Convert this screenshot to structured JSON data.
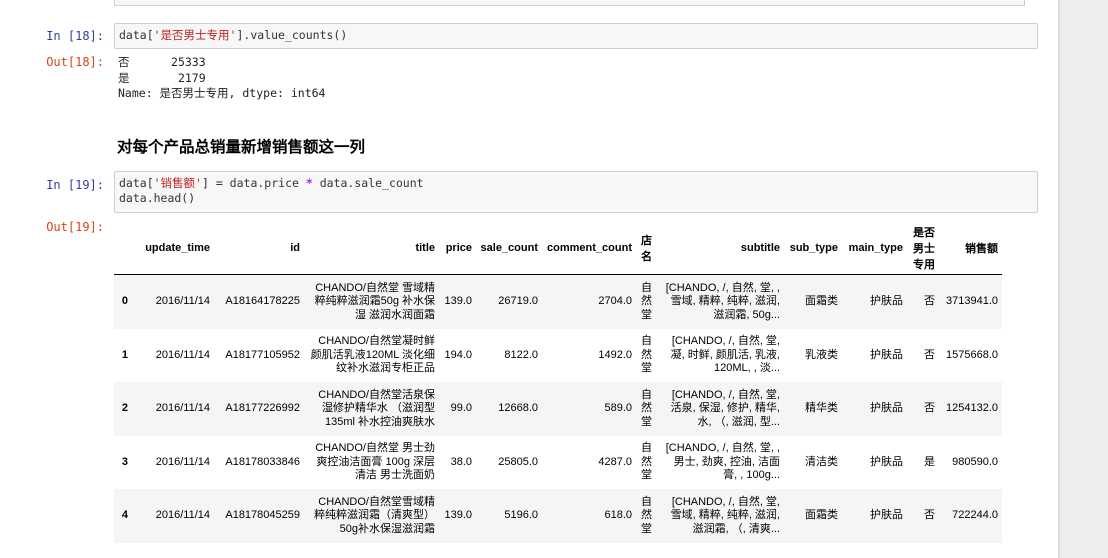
{
  "cell18": {
    "in_prompt": "In  [18]:",
    "code": {
      "a": "data[",
      "str": "'是否男士专用'",
      "b": "].value_counts()"
    },
    "out_prompt": "Out[18]:",
    "output_lines": [
      "否      25333",
      "是       2179",
      "Name: 是否男士专用, dtype: int64"
    ]
  },
  "markdown": {
    "heading": "对每个产品总销量新增销售额这一列"
  },
  "cell19": {
    "in_prompt": "In  [19]:",
    "code": {
      "a": "data[",
      "str": "'销售额'",
      "b": "] = data.price ",
      "op": "*",
      "c": " data.sale_count",
      "line2": "data.head()"
    },
    "out_prompt": "Out[19]:"
  },
  "table": {
    "columns": [
      "",
      "update_time",
      "id",
      "title",
      "price",
      "sale_count",
      "comment_count",
      "店名",
      "subtitle",
      "sub_type",
      "main_type",
      "是否男士专用",
      "销售额"
    ],
    "rows": [
      [
        "0",
        "2016/11/14",
        "A18164178225",
        "CHANDO/自然堂 雪域精粹纯粹滋润霜50g 补水保湿 滋润水润面霜",
        "139.0",
        "26719.0",
        "2704.0",
        "自然堂",
        "[CHANDO, /, 自然, 堂, , 雪域, 精粹, 纯粹, 滋润, 滋润霜, 50g...",
        "面霜类",
        "护肤品",
        "否",
        "3713941.0"
      ],
      [
        "1",
        "2016/11/14",
        "A18177105952",
        "CHANDO/自然堂凝时鲜颜肌活乳液120ML 淡化细纹补水滋润专柜正品",
        "194.0",
        "8122.0",
        "1492.0",
        "自然堂",
        "[CHANDO, /, 自然, 堂, 凝, 时鲜, 颜肌活, 乳液, 120ML, , 淡...",
        "乳液类",
        "护肤品",
        "否",
        "1575668.0"
      ],
      [
        "2",
        "2016/11/14",
        "A18177226992",
        "CHANDO/自然堂活泉保湿修护精华水 （滋润型135ml 补水控油爽肤水",
        "99.0",
        "12668.0",
        "589.0",
        "自然堂",
        "[CHANDO, /, 自然, 堂, 活泉, 保湿, 修护, 精华, 水, （, 滋润, 型...",
        "精华类",
        "护肤品",
        "否",
        "1254132.0"
      ],
      [
        "3",
        "2016/11/14",
        "A18178033846",
        "CHANDO/自然堂 男士劲爽控油洁面膏 100g 深层清洁 男士洗面奶",
        "38.0",
        "25805.0",
        "4287.0",
        "自然堂",
        "[CHANDO, /, 自然, 堂, , 男士, 劲爽, 控油, 洁面膏, , 100g...",
        "清洁类",
        "护肤品",
        "是",
        "980590.0"
      ],
      [
        "4",
        "2016/11/14",
        "A18178045259",
        "CHANDO/自然堂雪域精粹纯粹滋润霜（清爽型）50g补水保湿滋润霜",
        "139.0",
        "5196.0",
        "618.0",
        "自然堂",
        "[CHANDO, /, 自然, 堂, 雪域, 精粹, 纯粹, 滋润, 滋润霜, （, 清爽...",
        "面霜类",
        "护肤品",
        "否",
        "722244.0"
      ]
    ]
  }
}
